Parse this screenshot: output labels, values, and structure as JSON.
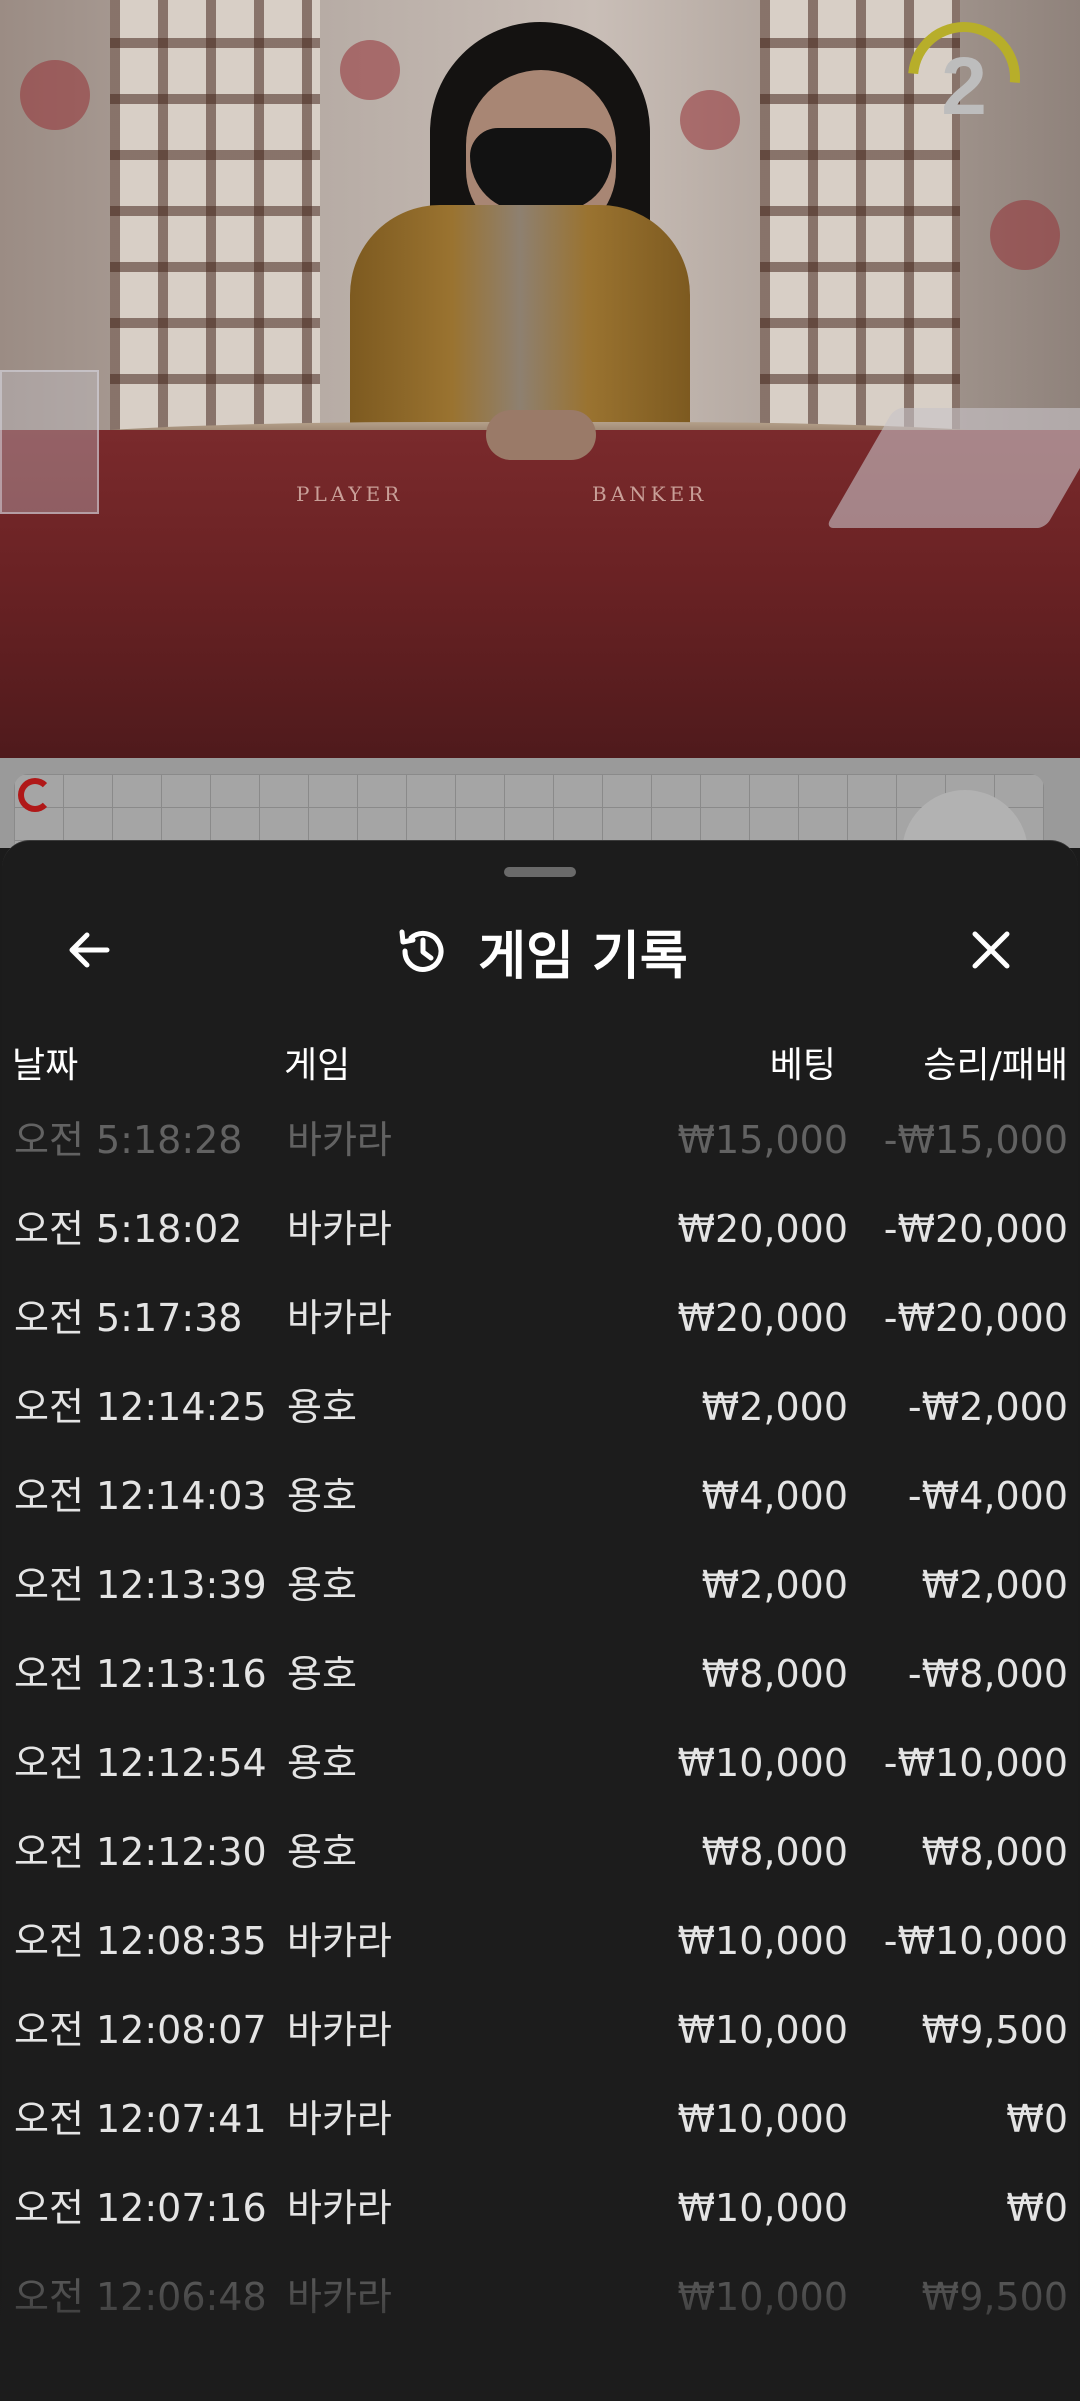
{
  "video": {
    "timer_value": "2",
    "table_labels": {
      "player": "PLAYER",
      "banker": "BANKER"
    }
  },
  "sheet": {
    "title": "게임 기록",
    "icons": {
      "back": "arrow-left-icon",
      "history": "history-icon",
      "close": "close-icon"
    }
  },
  "columns": {
    "date": "날짜",
    "game": "게임",
    "bet": "베팅",
    "result": "승리/패배"
  },
  "rows": [
    {
      "time": "오전 5:18:28",
      "game": "바카라",
      "bet": "₩15,000",
      "result": "-₩15,000"
    },
    {
      "time": "오전 5:18:02",
      "game": "바카라",
      "bet": "₩20,000",
      "result": "-₩20,000"
    },
    {
      "time": "오전 5:17:38",
      "game": "바카라",
      "bet": "₩20,000",
      "result": "-₩20,000"
    },
    {
      "time": "오전 12:14:25",
      "game": "용호",
      "bet": "₩2,000",
      "result": "-₩2,000"
    },
    {
      "time": "오전 12:14:03",
      "game": "용호",
      "bet": "₩4,000",
      "result": "-₩4,000"
    },
    {
      "time": "오전 12:13:39",
      "game": "용호",
      "bet": "₩2,000",
      "result": "₩2,000"
    },
    {
      "time": "오전 12:13:16",
      "game": "용호",
      "bet": "₩8,000",
      "result": "-₩8,000"
    },
    {
      "time": "오전 12:12:54",
      "game": "용호",
      "bet": "₩10,000",
      "result": "-₩10,000"
    },
    {
      "time": "오전 12:12:30",
      "game": "용호",
      "bet": "₩8,000",
      "result": "₩8,000"
    },
    {
      "time": "오전 12:08:35",
      "game": "바카라",
      "bet": "₩10,000",
      "result": "-₩10,000"
    },
    {
      "time": "오전 12:08:07",
      "game": "바카라",
      "bet": "₩10,000",
      "result": "₩9,500"
    },
    {
      "time": "오전 12:07:41",
      "game": "바카라",
      "bet": "₩10,000",
      "result": "₩0"
    },
    {
      "time": "오전 12:07:16",
      "game": "바카라",
      "bet": "₩10,000",
      "result": "₩0"
    },
    {
      "time": "오전 12:06:48",
      "game": "바카라",
      "bet": "₩10,000",
      "result": "₩9,500"
    }
  ]
}
